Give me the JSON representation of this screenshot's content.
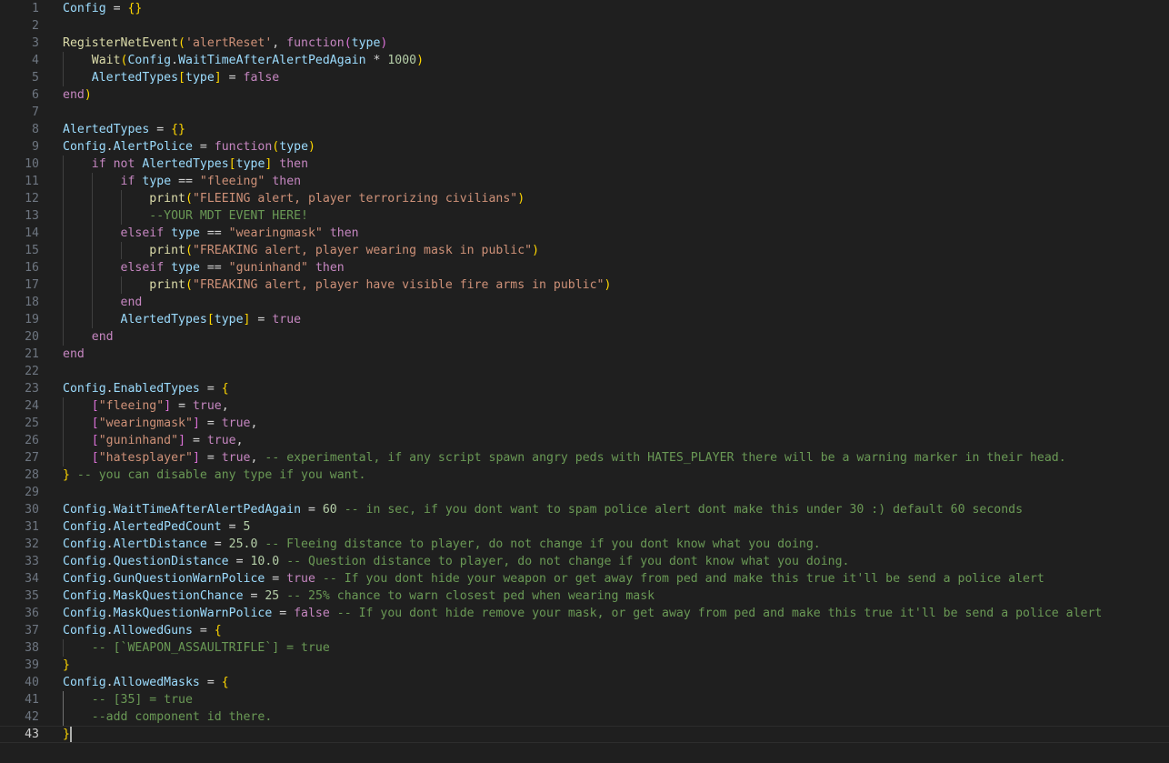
{
  "editor": {
    "theme": {
      "background": "#1f1f1f",
      "line_number": "#6e7681",
      "text": "#cccccc",
      "variable": "#9cdcfe",
      "function": "#dcdcaa",
      "keyword": "#c586c0",
      "string": "#ce9178",
      "number": "#b5cea8",
      "comment": "#6a9955",
      "bracket_1": "#ffd700",
      "bracket_2": "#da70d6",
      "bracket_3": "#179fff"
    },
    "current_line": 43,
    "lines": [
      [
        [
          "var",
          "Config"
        ],
        [
          "op",
          " = "
        ],
        [
          "br1",
          "{}"
        ]
      ],
      [],
      [
        [
          "fn",
          "RegisterNetEvent"
        ],
        [
          "br1",
          "("
        ],
        [
          "str",
          "'alertReset'"
        ],
        [
          "op",
          ", "
        ],
        [
          "kw",
          "function"
        ],
        [
          "br2",
          "("
        ],
        [
          "var",
          "type"
        ],
        [
          "br2",
          ")"
        ]
      ],
      [
        [
          "op",
          "    "
        ],
        [
          "fn",
          "Wait"
        ],
        [
          "br1",
          "("
        ],
        [
          "var",
          "Config"
        ],
        [
          "op",
          "."
        ],
        [
          "var",
          "WaitTimeAfterAlertPedAgain"
        ],
        [
          "op",
          " * "
        ],
        [
          "num",
          "1000"
        ],
        [
          "br1",
          ")"
        ]
      ],
      [
        [
          "op",
          "    "
        ],
        [
          "var",
          "AlertedTypes"
        ],
        [
          "br1",
          "["
        ],
        [
          "var",
          "type"
        ],
        [
          "br1",
          "]"
        ],
        [
          "op",
          " = "
        ],
        [
          "kw",
          "false"
        ]
      ],
      [
        [
          "kw",
          "end"
        ],
        [
          "br1",
          ")"
        ]
      ],
      [],
      [
        [
          "var",
          "AlertedTypes"
        ],
        [
          "op",
          " = "
        ],
        [
          "br1",
          "{}"
        ]
      ],
      [
        [
          "var",
          "Config"
        ],
        [
          "op",
          "."
        ],
        [
          "var",
          "AlertPolice"
        ],
        [
          "op",
          " = "
        ],
        [
          "kw",
          "function"
        ],
        [
          "br1",
          "("
        ],
        [
          "var",
          "type"
        ],
        [
          "br1",
          ")"
        ]
      ],
      [
        [
          "op",
          "    "
        ],
        [
          "kw",
          "if"
        ],
        [
          "op",
          " "
        ],
        [
          "kw",
          "not"
        ],
        [
          "op",
          " "
        ],
        [
          "var",
          "AlertedTypes"
        ],
        [
          "br1",
          "["
        ],
        [
          "var",
          "type"
        ],
        [
          "br1",
          "]"
        ],
        [
          "op",
          " "
        ],
        [
          "kw",
          "then"
        ]
      ],
      [
        [
          "op",
          "        "
        ],
        [
          "kw",
          "if"
        ],
        [
          "op",
          " "
        ],
        [
          "var",
          "type"
        ],
        [
          "op",
          " == "
        ],
        [
          "str",
          "\"fleeing\""
        ],
        [
          "op",
          " "
        ],
        [
          "kw",
          "then"
        ]
      ],
      [
        [
          "op",
          "            "
        ],
        [
          "fn",
          "print"
        ],
        [
          "br1",
          "("
        ],
        [
          "str",
          "\"FLEEING alert, player terrorizing civilians\""
        ],
        [
          "br1",
          ")"
        ]
      ],
      [
        [
          "op",
          "            "
        ],
        [
          "cm",
          "--YOUR MDT EVENT HERE!"
        ]
      ],
      [
        [
          "op",
          "        "
        ],
        [
          "kw",
          "elseif"
        ],
        [
          "op",
          " "
        ],
        [
          "var",
          "type"
        ],
        [
          "op",
          " == "
        ],
        [
          "str",
          "\"wearingmask\""
        ],
        [
          "op",
          " "
        ],
        [
          "kw",
          "then"
        ]
      ],
      [
        [
          "op",
          "            "
        ],
        [
          "fn",
          "print"
        ],
        [
          "br1",
          "("
        ],
        [
          "str",
          "\"FREAKING alert, player wearing mask in public\""
        ],
        [
          "br1",
          ")"
        ]
      ],
      [
        [
          "op",
          "        "
        ],
        [
          "kw",
          "elseif"
        ],
        [
          "op",
          " "
        ],
        [
          "var",
          "type"
        ],
        [
          "op",
          " == "
        ],
        [
          "str",
          "\"guninhand\""
        ],
        [
          "op",
          " "
        ],
        [
          "kw",
          "then"
        ]
      ],
      [
        [
          "op",
          "            "
        ],
        [
          "fn",
          "print"
        ],
        [
          "br1",
          "("
        ],
        [
          "str",
          "\"FREAKING alert, player have visible fire arms in public\""
        ],
        [
          "br1",
          ")"
        ]
      ],
      [
        [
          "op",
          "        "
        ],
        [
          "kw",
          "end"
        ]
      ],
      [
        [
          "op",
          "        "
        ],
        [
          "var",
          "AlertedTypes"
        ],
        [
          "br1",
          "["
        ],
        [
          "var",
          "type"
        ],
        [
          "br1",
          "]"
        ],
        [
          "op",
          " = "
        ],
        [
          "kw",
          "true"
        ]
      ],
      [
        [
          "op",
          "    "
        ],
        [
          "kw",
          "end"
        ]
      ],
      [
        [
          "kw",
          "end"
        ]
      ],
      [],
      [
        [
          "var",
          "Config"
        ],
        [
          "op",
          "."
        ],
        [
          "var",
          "EnabledTypes"
        ],
        [
          "op",
          " = "
        ],
        [
          "br1",
          "{"
        ]
      ],
      [
        [
          "op",
          "    "
        ],
        [
          "br2",
          "["
        ],
        [
          "str",
          "\"fleeing\""
        ],
        [
          "br2",
          "]"
        ],
        [
          "op",
          " = "
        ],
        [
          "kw",
          "true"
        ],
        [
          "op",
          ","
        ]
      ],
      [
        [
          "op",
          "    "
        ],
        [
          "br2",
          "["
        ],
        [
          "str",
          "\"wearingmask\""
        ],
        [
          "br2",
          "]"
        ],
        [
          "op",
          " = "
        ],
        [
          "kw",
          "true"
        ],
        [
          "op",
          ","
        ]
      ],
      [
        [
          "op",
          "    "
        ],
        [
          "br2",
          "["
        ],
        [
          "str",
          "\"guninhand\""
        ],
        [
          "br2",
          "]"
        ],
        [
          "op",
          " = "
        ],
        [
          "kw",
          "true"
        ],
        [
          "op",
          ","
        ]
      ],
      [
        [
          "op",
          "    "
        ],
        [
          "br2",
          "["
        ],
        [
          "str",
          "\"hatesplayer\""
        ],
        [
          "br2",
          "]"
        ],
        [
          "op",
          " = "
        ],
        [
          "kw",
          "true"
        ],
        [
          "op",
          ", "
        ],
        [
          "cm",
          "-- experimental, if any script spawn angry peds with HATES_PLAYER there will be a warning marker in their head."
        ]
      ],
      [
        [
          "br1",
          "}"
        ],
        [
          "op",
          " "
        ],
        [
          "cm",
          "-- you can disable any type if you want."
        ]
      ],
      [],
      [
        [
          "var",
          "Config"
        ],
        [
          "op",
          "."
        ],
        [
          "var",
          "WaitTimeAfterAlertPedAgain"
        ],
        [
          "op",
          " = "
        ],
        [
          "num",
          "60"
        ],
        [
          "op",
          " "
        ],
        [
          "cm",
          "-- in sec, if you dont want to spam police alert dont make this under 30 :) default 60 seconds"
        ]
      ],
      [
        [
          "var",
          "Config"
        ],
        [
          "op",
          "."
        ],
        [
          "var",
          "AlertedPedCount"
        ],
        [
          "op",
          " = "
        ],
        [
          "num",
          "5"
        ]
      ],
      [
        [
          "var",
          "Config"
        ],
        [
          "op",
          "."
        ],
        [
          "var",
          "AlertDistance"
        ],
        [
          "op",
          " = "
        ],
        [
          "num",
          "25.0"
        ],
        [
          "op",
          " "
        ],
        [
          "cm",
          "-- Fleeing distance to player, do not change if you dont know what you doing."
        ]
      ],
      [
        [
          "var",
          "Config"
        ],
        [
          "op",
          "."
        ],
        [
          "var",
          "QuestionDistance"
        ],
        [
          "op",
          " = "
        ],
        [
          "num",
          "10.0"
        ],
        [
          "op",
          " "
        ],
        [
          "cm",
          "-- Question distance to player, do not change if you dont know what you doing."
        ]
      ],
      [
        [
          "var",
          "Config"
        ],
        [
          "op",
          "."
        ],
        [
          "var",
          "GunQuestionWarnPolice"
        ],
        [
          "op",
          " = "
        ],
        [
          "kw",
          "true"
        ],
        [
          "op",
          " "
        ],
        [
          "cm",
          "-- If you dont hide your weapon or get away from ped and make this true it'll be send a police alert"
        ]
      ],
      [
        [
          "var",
          "Config"
        ],
        [
          "op",
          "."
        ],
        [
          "var",
          "MaskQuestionChance"
        ],
        [
          "op",
          " = "
        ],
        [
          "num",
          "25"
        ],
        [
          "op",
          " "
        ],
        [
          "cm",
          "-- 25% chance to warn closest ped when wearing mask"
        ]
      ],
      [
        [
          "var",
          "Config"
        ],
        [
          "op",
          "."
        ],
        [
          "var",
          "MaskQuestionWarnPolice"
        ],
        [
          "op",
          " = "
        ],
        [
          "kw",
          "false"
        ],
        [
          "op",
          " "
        ],
        [
          "cm",
          "-- If you dont hide remove your mask, or get away from ped and make this true it'll be send a police alert"
        ]
      ],
      [
        [
          "var",
          "Config"
        ],
        [
          "op",
          "."
        ],
        [
          "var",
          "AllowedGuns"
        ],
        [
          "op",
          " = "
        ],
        [
          "br1",
          "{"
        ]
      ],
      [
        [
          "op",
          "    "
        ],
        [
          "cm",
          "-- [`WEAPON_ASSAULTRIFLE`] = true"
        ]
      ],
      [
        [
          "br1",
          "}"
        ]
      ],
      [
        [
          "var",
          "Config"
        ],
        [
          "op",
          "."
        ],
        [
          "var",
          "AllowedMasks"
        ],
        [
          "op",
          " = "
        ],
        [
          "br1",
          "{"
        ]
      ],
      [
        [
          "op",
          "    "
        ],
        [
          "cm",
          "-- [35] = true"
        ]
      ],
      [
        [
          "op",
          "    "
        ],
        [
          "cm",
          "--add component id there."
        ]
      ],
      [
        [
          "br1",
          "}"
        ]
      ]
    ]
  }
}
